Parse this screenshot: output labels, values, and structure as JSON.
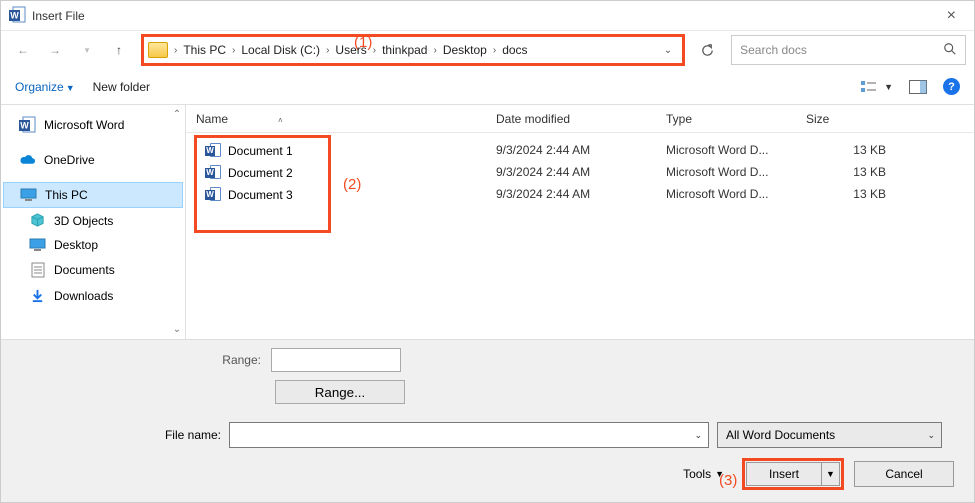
{
  "window": {
    "title": "Insert File"
  },
  "annotations": {
    "a1": "(1)",
    "a2": "(2)",
    "a3": "(3)"
  },
  "breadcrumb": {
    "items": [
      "This PC",
      "Local Disk (C:)",
      "Users",
      "thinkpad",
      "Desktop",
      "docs"
    ]
  },
  "search": {
    "placeholder": "Search docs"
  },
  "toolbar": {
    "organize": "Organize",
    "newFolder": "New folder"
  },
  "sidebar": {
    "items": [
      {
        "label": "Microsoft Word",
        "icon": "word"
      },
      {
        "label": "OneDrive",
        "icon": "cloud"
      },
      {
        "label": "This PC",
        "icon": "pc"
      },
      {
        "label": "3D Objects",
        "icon": "3d"
      },
      {
        "label": "Desktop",
        "icon": "desktop"
      },
      {
        "label": "Documents",
        "icon": "documents"
      },
      {
        "label": "Downloads",
        "icon": "downloads"
      }
    ]
  },
  "columns": {
    "name": "Name",
    "date": "Date modified",
    "type": "Type",
    "size": "Size"
  },
  "files": [
    {
      "name": "Document 1",
      "date": "9/3/2024 2:44 AM",
      "type": "Microsoft Word D...",
      "size": "13 KB"
    },
    {
      "name": "Document 2",
      "date": "9/3/2024 2:44 AM",
      "type": "Microsoft Word D...",
      "size": "13 KB"
    },
    {
      "name": "Document 3",
      "date": "9/3/2024 2:44 AM",
      "type": "Microsoft Word D...",
      "size": "13 KB"
    }
  ],
  "bottom": {
    "rangeLabel": "Range:",
    "rangeButton": "Range...",
    "fileNameLabel": "File name:",
    "fileNameValue": "",
    "typeFilter": "All Word Documents",
    "tools": "Tools",
    "insert": "Insert",
    "cancel": "Cancel"
  }
}
